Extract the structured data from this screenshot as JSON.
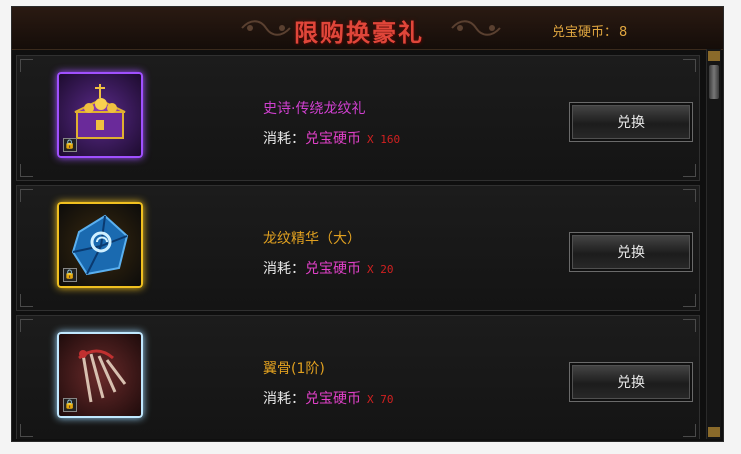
{
  "header": {
    "title": "限购换豪礼",
    "coin_label": "兑宝硬币：",
    "coin_value": "8"
  },
  "items": [
    {
      "name": "史诗·传绕龙纹礼",
      "name_color": "#d040d0",
      "frame_color": "#a050ff",
      "icon": "treasure-chest-icon",
      "cost_label": "消耗：",
      "currency": "兑宝硬币",
      "quantity": "X 160",
      "button": "兑换"
    },
    {
      "name": "龙纹精华（大）",
      "name_color": "#e0a020",
      "frame_color": "#f0c020",
      "icon": "blue-crystal-icon",
      "cost_label": "消耗：",
      "currency": "兑宝硬币",
      "quantity": "X 20",
      "button": "兑换"
    },
    {
      "name": "翼骨(1阶)",
      "name_color": "#e0a020",
      "frame_color": "#a0d8ff",
      "icon": "wing-bone-icon",
      "cost_label": "消耗：",
      "currency": "兑宝硬币",
      "quantity": "X 70",
      "button": "兑换"
    }
  ]
}
